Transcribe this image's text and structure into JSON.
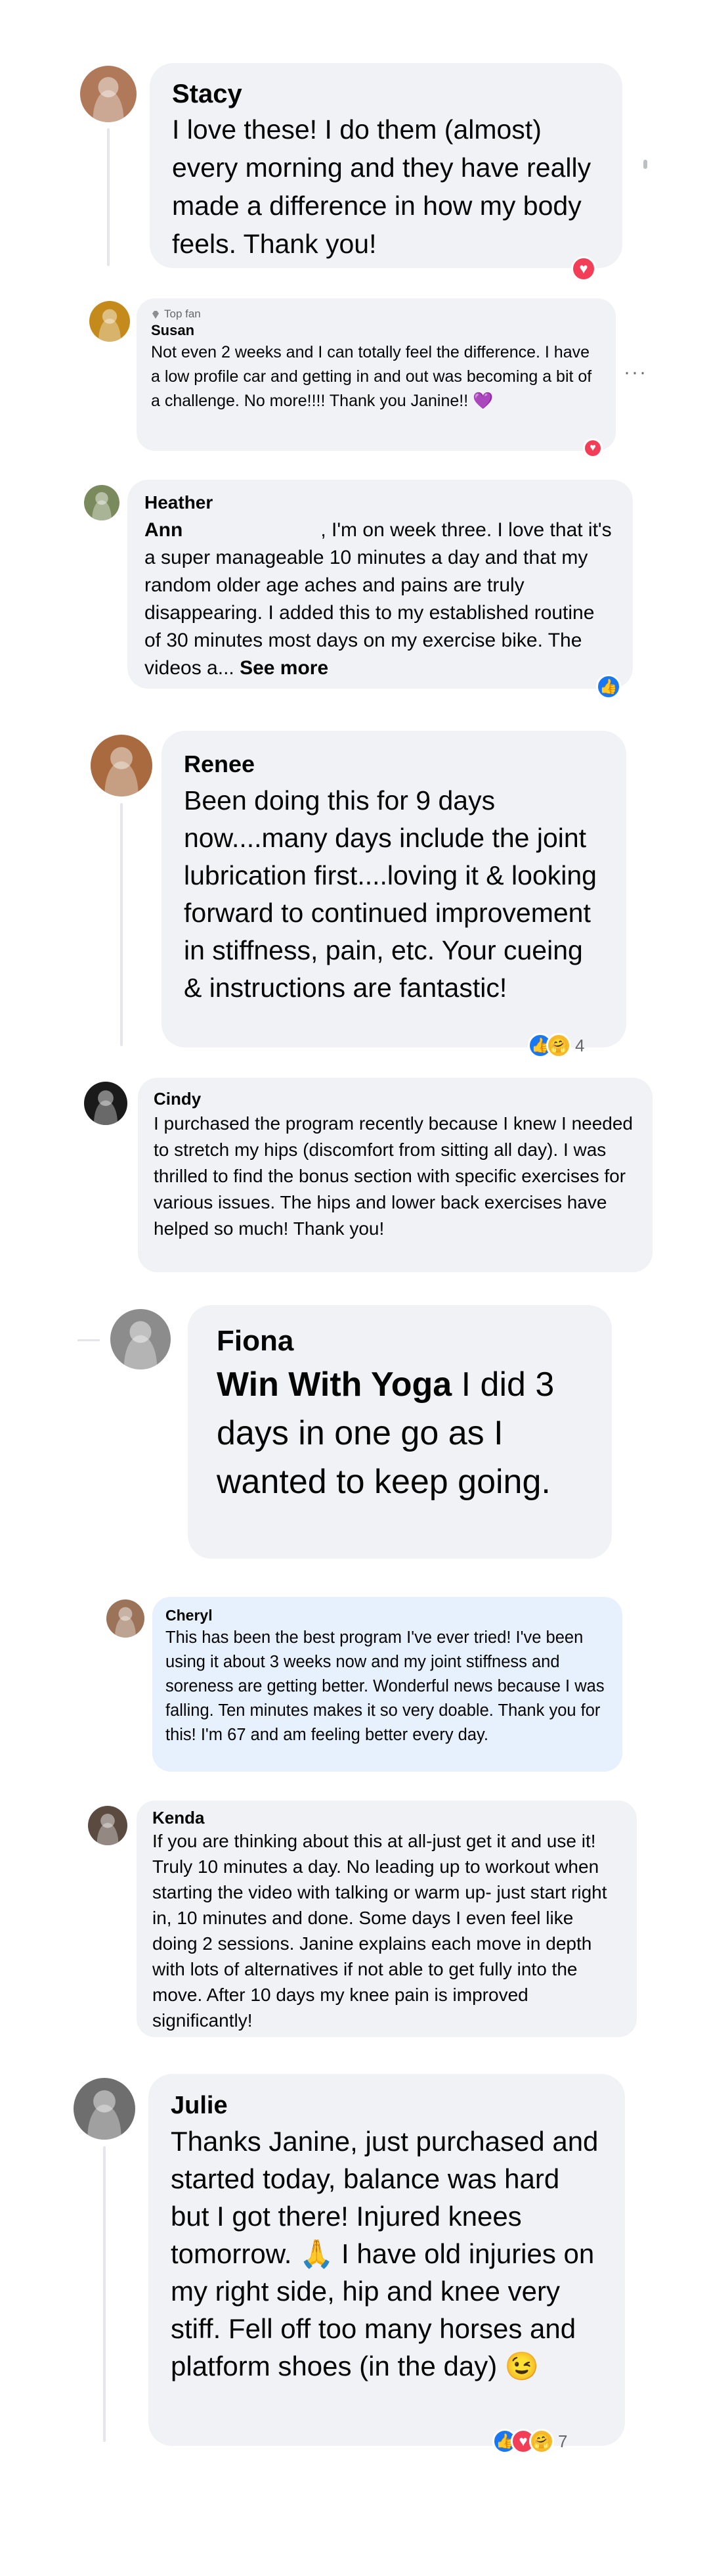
{
  "colors": {
    "bubble": "#f0f2f5",
    "bubble_highlight": "#e7f0fd",
    "like": "#1877f2",
    "love": "#f33e58",
    "care": "#f7b928"
  },
  "comments": [
    {
      "name": "Stacy",
      "text": "I love these! I do them (almost) every morning and they have really made a difference in how my body feels. Thank you!"
    },
    {
      "badge": "Top fan",
      "name": "Susan",
      "text": "Not even 2 weeks and I can totally feel the difference. I have a low profile car and getting in and out was becoming a bit of a challenge. No more!!!! Thank you Janine!! 💜",
      "menu": "···"
    },
    {
      "name_line1": "Heather",
      "name_line2": "Ann",
      "text_first": ", I'm on week three. I love that it's",
      "text": "a super manageable 10 minutes a day and that my random older age aches and pains are truly disappearing. I added this to my established routine of 30 minutes most days on my exercise bike. The videos a...",
      "see_more": "See more"
    },
    {
      "name": "Renee",
      "text": "Been doing this for 9 days now....many days include the joint lubrication first....loving it & looking forward to continued improvement in stiffness, pain, etc. Your cueing & instructions are fantastic!",
      "reaction_count": "4"
    },
    {
      "name": "Cindy",
      "text": "I purchased the program recently because I knew I needed to stretch my hips (discomfort from sitting all day). I was thrilled to find the bonus section with specific exercises for various issues. The hips and lower back exercises have helped so much! Thank you!"
    },
    {
      "name": "Fiona",
      "mention": "Win With Yoga",
      "text": " I did 3 days in one go as I wanted to keep going."
    },
    {
      "name": "Cheryl",
      "text": "This has been the best program I've ever tried! I've been using it about 3 weeks now and my joint stiffness and soreness are getting better. Wonderful news because I was falling. Ten minutes makes it so very doable. Thank you for this! I'm 67 and am feeling better every day."
    },
    {
      "name": "Kenda",
      "text": "If you are thinking about this at all-just get it and use it! Truly 10 minutes a day. No leading up to workout when starting the video with talking or warm up- just start right in, 10 minutes and done. Some days I even feel like doing 2 sessions. Janine explains each move in depth with lots of alternatives if not able to get fully into the move. After 10 days my knee pain is improved significantly!"
    },
    {
      "name": "Julie",
      "text": "Thanks Janine, just purchased and started today, balance was hard but I got there! Injured knees tomorrow. 🙏 I have old injuries on my right side, hip and knee very stiff. Fell off too many horses and platform shoes (in the day) 😉",
      "reaction_count": "7"
    }
  ]
}
